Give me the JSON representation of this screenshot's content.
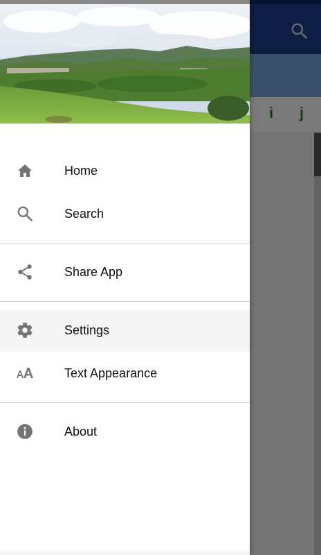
{
  "app": {
    "letters": [
      "i",
      "j"
    ],
    "colors": {
      "appbar": "#1e3f8f",
      "subbar": "#7aa6dd",
      "letter": "#2e7d32"
    }
  },
  "drawer": {
    "header_image": "landscape-photo",
    "menu_items": [
      {
        "label": "Home",
        "icon": "home-icon"
      },
      {
        "label": "Search",
        "icon": "search-icon"
      },
      {
        "label": "Share App",
        "icon": "share-icon"
      },
      {
        "label": "Settings",
        "icon": "gear-icon",
        "selected": true
      },
      {
        "label": "Text Appearance",
        "icon": "text-size-icon"
      },
      {
        "label": "About",
        "icon": "info-icon"
      }
    ]
  }
}
